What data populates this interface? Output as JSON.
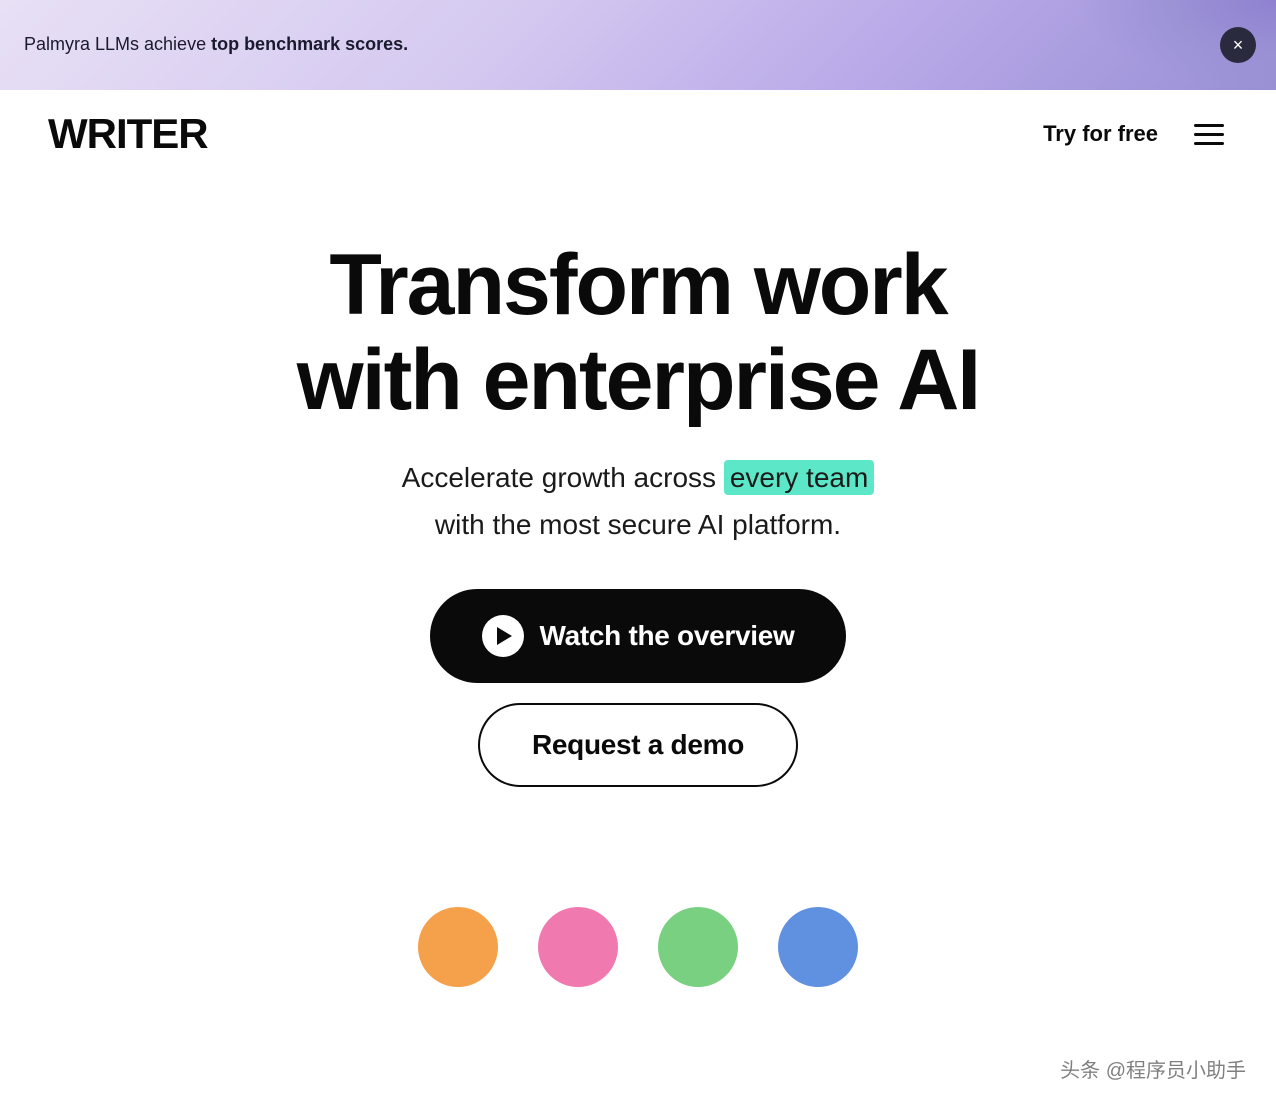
{
  "banner": {
    "text_normal": "Palmyra LLMs achieve ",
    "text_bold": "top benchmark scores.",
    "close_label": "×"
  },
  "navbar": {
    "logo": "WRITER",
    "try_free": "Try for free",
    "menu_label": "menu"
  },
  "hero": {
    "title_line1": "Transform work",
    "title_line2": "with enterprise AI",
    "subtitle_part1": "Accelerate growth across ",
    "subtitle_highlight": "every team",
    "subtitle_part2": "with the most secure AI platform.",
    "cta_primary": "Watch the overview",
    "cta_secondary": "Request a demo"
  },
  "icons": {
    "colors": [
      "#f5a04a",
      "#f07ab0",
      "#78d080",
      "#6090e0"
    ]
  },
  "watermark": "头条 @程序员小助手"
}
